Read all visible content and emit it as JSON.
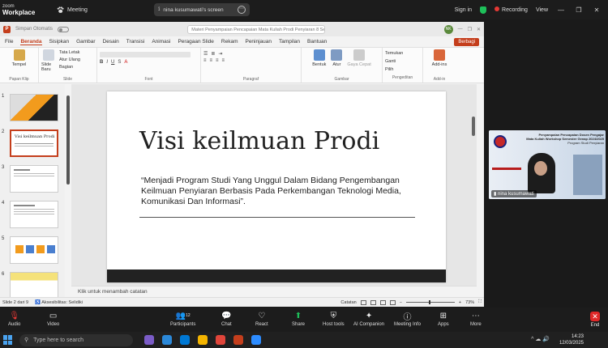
{
  "zoom_top": {
    "logo_line1": "zoom",
    "logo_line2": "Workplace",
    "meeting_label": "Meeting",
    "screen_share_label": "nina kusumawati's screen",
    "sign_in": "Sign in",
    "recording": "Recording",
    "view": "View"
  },
  "ppt": {
    "autosave_label": "Simpan Otomatis",
    "title_search": "Materi Penyampaian Pencapaian Mata Kuliah Prodi Penyiaran 8 Sep, 2023 - Disimpan ke PC ini",
    "avatar": "NK",
    "tabs": [
      "File",
      "Beranda",
      "Sisipkan",
      "Gambar",
      "Desain",
      "Transisi",
      "Animasi",
      "Peragaan Slide",
      "Rekam",
      "Peninjauan",
      "Tampilan",
      "Bantuan"
    ],
    "share_button": "Berbagi",
    "ribbon": {
      "paste": "Tempel",
      "clipboard": "Papan Klip",
      "new_slide": "Slide Baru",
      "layout": "Tata Letak",
      "reset": "Atur Ulang",
      "section": "Bagian",
      "slide_group": "Slide",
      "font_group": "Font",
      "paragraph_group": "Paragraf",
      "shape": "Bentuk",
      "arrange": "Atur",
      "quick_styles": "Gaya Cepat",
      "drawing_group": "Gambar",
      "find": "Temukan",
      "replace": "Ganti",
      "select": "Pilih",
      "editing_group": "Pengeditan",
      "addins": "Add-ins",
      "addins_group": "Add-in"
    },
    "thumb_numbers": [
      "1",
      "2",
      "3",
      "4",
      "5",
      "6"
    ],
    "slide": {
      "title": "Visi keilmuan Prodi",
      "body": "“Menjadi Program Studi Yang Unggul Dalam Bidang Pengembangan Keilmuan Penyiaran Berbasis Pada Perkembangan Teknologi Media, Komunikasi Dan Informasi”."
    },
    "notes_placeholder": "Klik untuk menambah catatan",
    "status": {
      "slide_count": "Slide 2 dari 9",
      "accessibility": "Aksesibilitas: Selidiki",
      "notes": "Catatan",
      "zoom": "73%"
    }
  },
  "video": {
    "header_line1": "Penyampaian Pencapaian Dosen Pengajar",
    "header_line2": "Mata Kuliah Workshop Semester Genap 2024/2025",
    "header_line3": "Program Studi Penyiaran",
    "participant_name": "nina kusumawati"
  },
  "zoom_controls": {
    "audio": "Audio",
    "video": "Video",
    "participants": "Participants",
    "participants_count": "12",
    "chat": "Chat",
    "react": "React",
    "share": "Share",
    "host_tools": "Host tools",
    "ai_companion": "AI Companion",
    "meeting_info": "Meeting Info",
    "apps": "Apps",
    "more": "More",
    "end": "End"
  },
  "taskbar": {
    "search_placeholder": "Type here to search",
    "time": "14:23",
    "date": "12/03/2025"
  },
  "colors": {
    "ppt_accent": "#c43e1c",
    "zoom_end": "#e02828",
    "recording": "#e53935"
  }
}
